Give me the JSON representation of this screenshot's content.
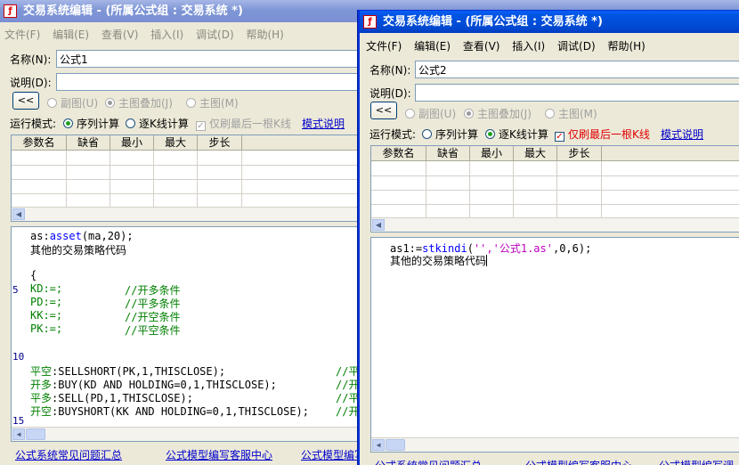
{
  "win1": {
    "title": "交易系统编辑 - (所属公式组 : 交易系统 *)",
    "menu": [
      "文件(F)",
      "编辑(E)",
      "查看(V)",
      "插入(I)",
      "调试(D)",
      "帮助(H)"
    ],
    "name_label": "名称(N):",
    "name_value": "公式1",
    "desc_label": "说明(D):",
    "desc_value": "",
    "collapse_label": "<<",
    "chart_modes": [
      "副图(U)",
      "主图叠加(J)",
      "主图(M)"
    ],
    "run_mode_label": "运行模式:",
    "run_modes": [
      "序列计算",
      "逐K线计算"
    ],
    "only_last_label": "仅刷最后一根K线",
    "mode_help": "模式说明",
    "param_headers": [
      "参数名",
      "缺省",
      "最小",
      "最大",
      "步长"
    ],
    "line_numbers": [
      "5",
      "10",
      "15"
    ],
    "code": {
      "l1_a": "as:",
      "l1_b": "asset",
      "l1_c": "(ma,20);",
      "l2": "其他的交易策略代码",
      "l3": "{",
      "kd": "KD:=;",
      "kd_c": "//开多条件",
      "pd": "PD:=;",
      "pd_c": "//平多条件",
      "kk": "KK:=;",
      "kk_c": "//开空条件",
      "pk": "PK:=;",
      "pk_c": "//平空条件",
      "t1_a": "平空",
      "t1_b": ":SELLSHORT(PK,1,THISCLOSE);",
      "t1_c": "//平",
      "t2_a": "开多",
      "t2_b": ":BUY(KD AND HOLDING=0,1,THISCLOSE);",
      "t2_c": "//开",
      "t3_a": "平多",
      "t3_b": ":SELL(PD,1,THISCLOSE);",
      "t3_c": "//平",
      "t4_a": "开空",
      "t4_b": ":BUYSHORT(KK AND HOLDING=0,1,THISCLOSE);",
      "t4_c": "//开"
    },
    "bottom_links": [
      "公式系统常见问题汇总",
      "公式模型编写客服中心",
      "公式模型编写"
    ]
  },
  "win2": {
    "title": "交易系统编辑 - (所属公式组 : 交易系统 *)",
    "menu": [
      "文件(F)",
      "编辑(E)",
      "查看(V)",
      "插入(I)",
      "调试(D)",
      "帮助(H)"
    ],
    "name_label": "名称(N):",
    "name_value": "公式2",
    "desc_label": "说明(D):",
    "desc_value": "",
    "collapse_label": "<<",
    "chart_modes": [
      "副图(U)",
      "主图叠加(J)",
      "主图(M)"
    ],
    "run_mode_label": "运行模式:",
    "run_modes": [
      "序列计算",
      "逐K线计算"
    ],
    "only_last_label": "仅刷最后一根K线",
    "mode_help": "模式说明",
    "param_headers": [
      "参数名",
      "缺省",
      "最小",
      "最大",
      "步长"
    ],
    "code": {
      "l1_a": "as1:=",
      "l1_b": "stkindi",
      "l1_c": "(",
      "l1_d": "'',",
      "l1_e": "'公式1.as'",
      "l1_f": ",0,6);",
      "l2": "其他的交易策略代码"
    },
    "bottom_links": [
      "公式系统常见问题汇总",
      "公式模型编写客服中心",
      "公式模型编写调"
    ]
  }
}
